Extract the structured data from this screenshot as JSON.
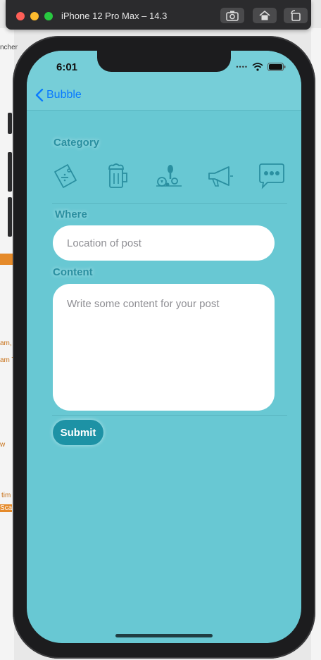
{
  "simulator": {
    "title": "iPhone 12 Pro Max – 14.3"
  },
  "status_bar": {
    "time": "6:01"
  },
  "nav": {
    "back_label": "Bubble"
  },
  "form": {
    "category_label": "Category",
    "categories": [
      "price-tag-icon",
      "beer-mug-icon",
      "sports-icon",
      "megaphone-icon",
      "more-chat-icon"
    ],
    "where_label": "Where",
    "where_placeholder": "Location of post",
    "content_label": "Content",
    "content_placeholder": "Write some content for your post",
    "submit_label": "Submit"
  },
  "background_fragments": [
    "ncher",
    "am,",
    "am T",
    "w",
    "tim",
    "Sca"
  ],
  "colors": {
    "screen_bg": "#68c8d3",
    "accent": "#1d92a5",
    "label": "#2a8fa0",
    "link": "#0a7aff"
  }
}
